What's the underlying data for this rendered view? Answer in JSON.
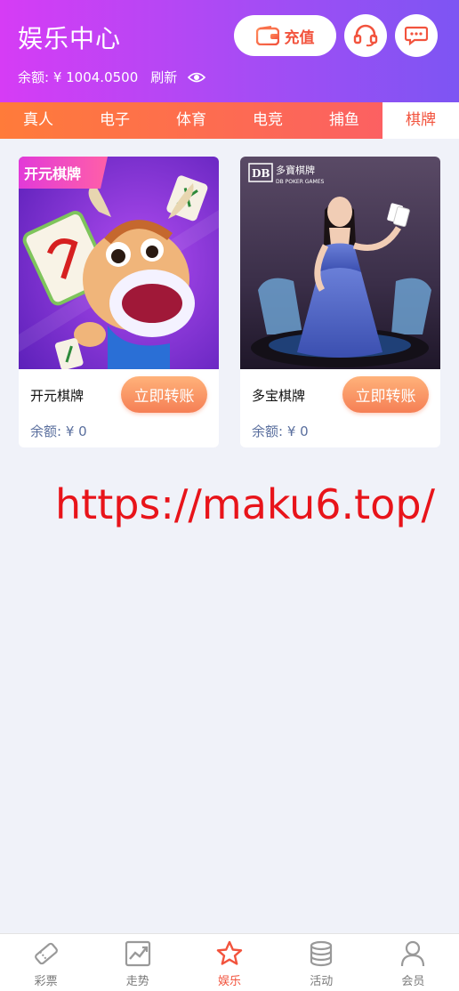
{
  "header": {
    "title": "娱乐中心",
    "balance_label": "余额: ¥ 1004.0500",
    "refresh_label": "刷新",
    "recharge_label": "充值",
    "service_icon": "headset-icon",
    "message_icon": "chat-icon"
  },
  "tabs": [
    {
      "label": "真人",
      "active": false
    },
    {
      "label": "电子",
      "active": false
    },
    {
      "label": "体育",
      "active": false
    },
    {
      "label": "电竞",
      "active": false
    },
    {
      "label": "捕鱼",
      "active": false
    },
    {
      "label": "棋牌",
      "active": true
    }
  ],
  "games": [
    {
      "name": "开元棋牌",
      "balance": "余额: ¥ 0",
      "button": "立即转账",
      "banner_text": "开元棋牌"
    },
    {
      "name": "多宝棋牌",
      "balance": "余额: ¥ 0",
      "button": "立即转账",
      "banner_text": "多寶棋牌",
      "banner_sub": "DB POKER GAMES"
    }
  ],
  "watermark": "https://maku6.top/",
  "bottom_nav": [
    {
      "label": "彩票",
      "icon": "lottery-icon",
      "active": false
    },
    {
      "label": "走势",
      "icon": "trend-icon",
      "active": false
    },
    {
      "label": "娱乐",
      "icon": "star-icon",
      "active": true
    },
    {
      "label": "活动",
      "icon": "coins-icon",
      "active": false
    },
    {
      "label": "会员",
      "icon": "user-icon",
      "active": false
    }
  ],
  "colors": {
    "header_start": "#d63cf5",
    "header_end": "#7d55f3",
    "tab_start": "#ff7b3a",
    "tab_end": "#fb5b6a",
    "accent": "#f2533d",
    "watermark": "#e8141a"
  }
}
